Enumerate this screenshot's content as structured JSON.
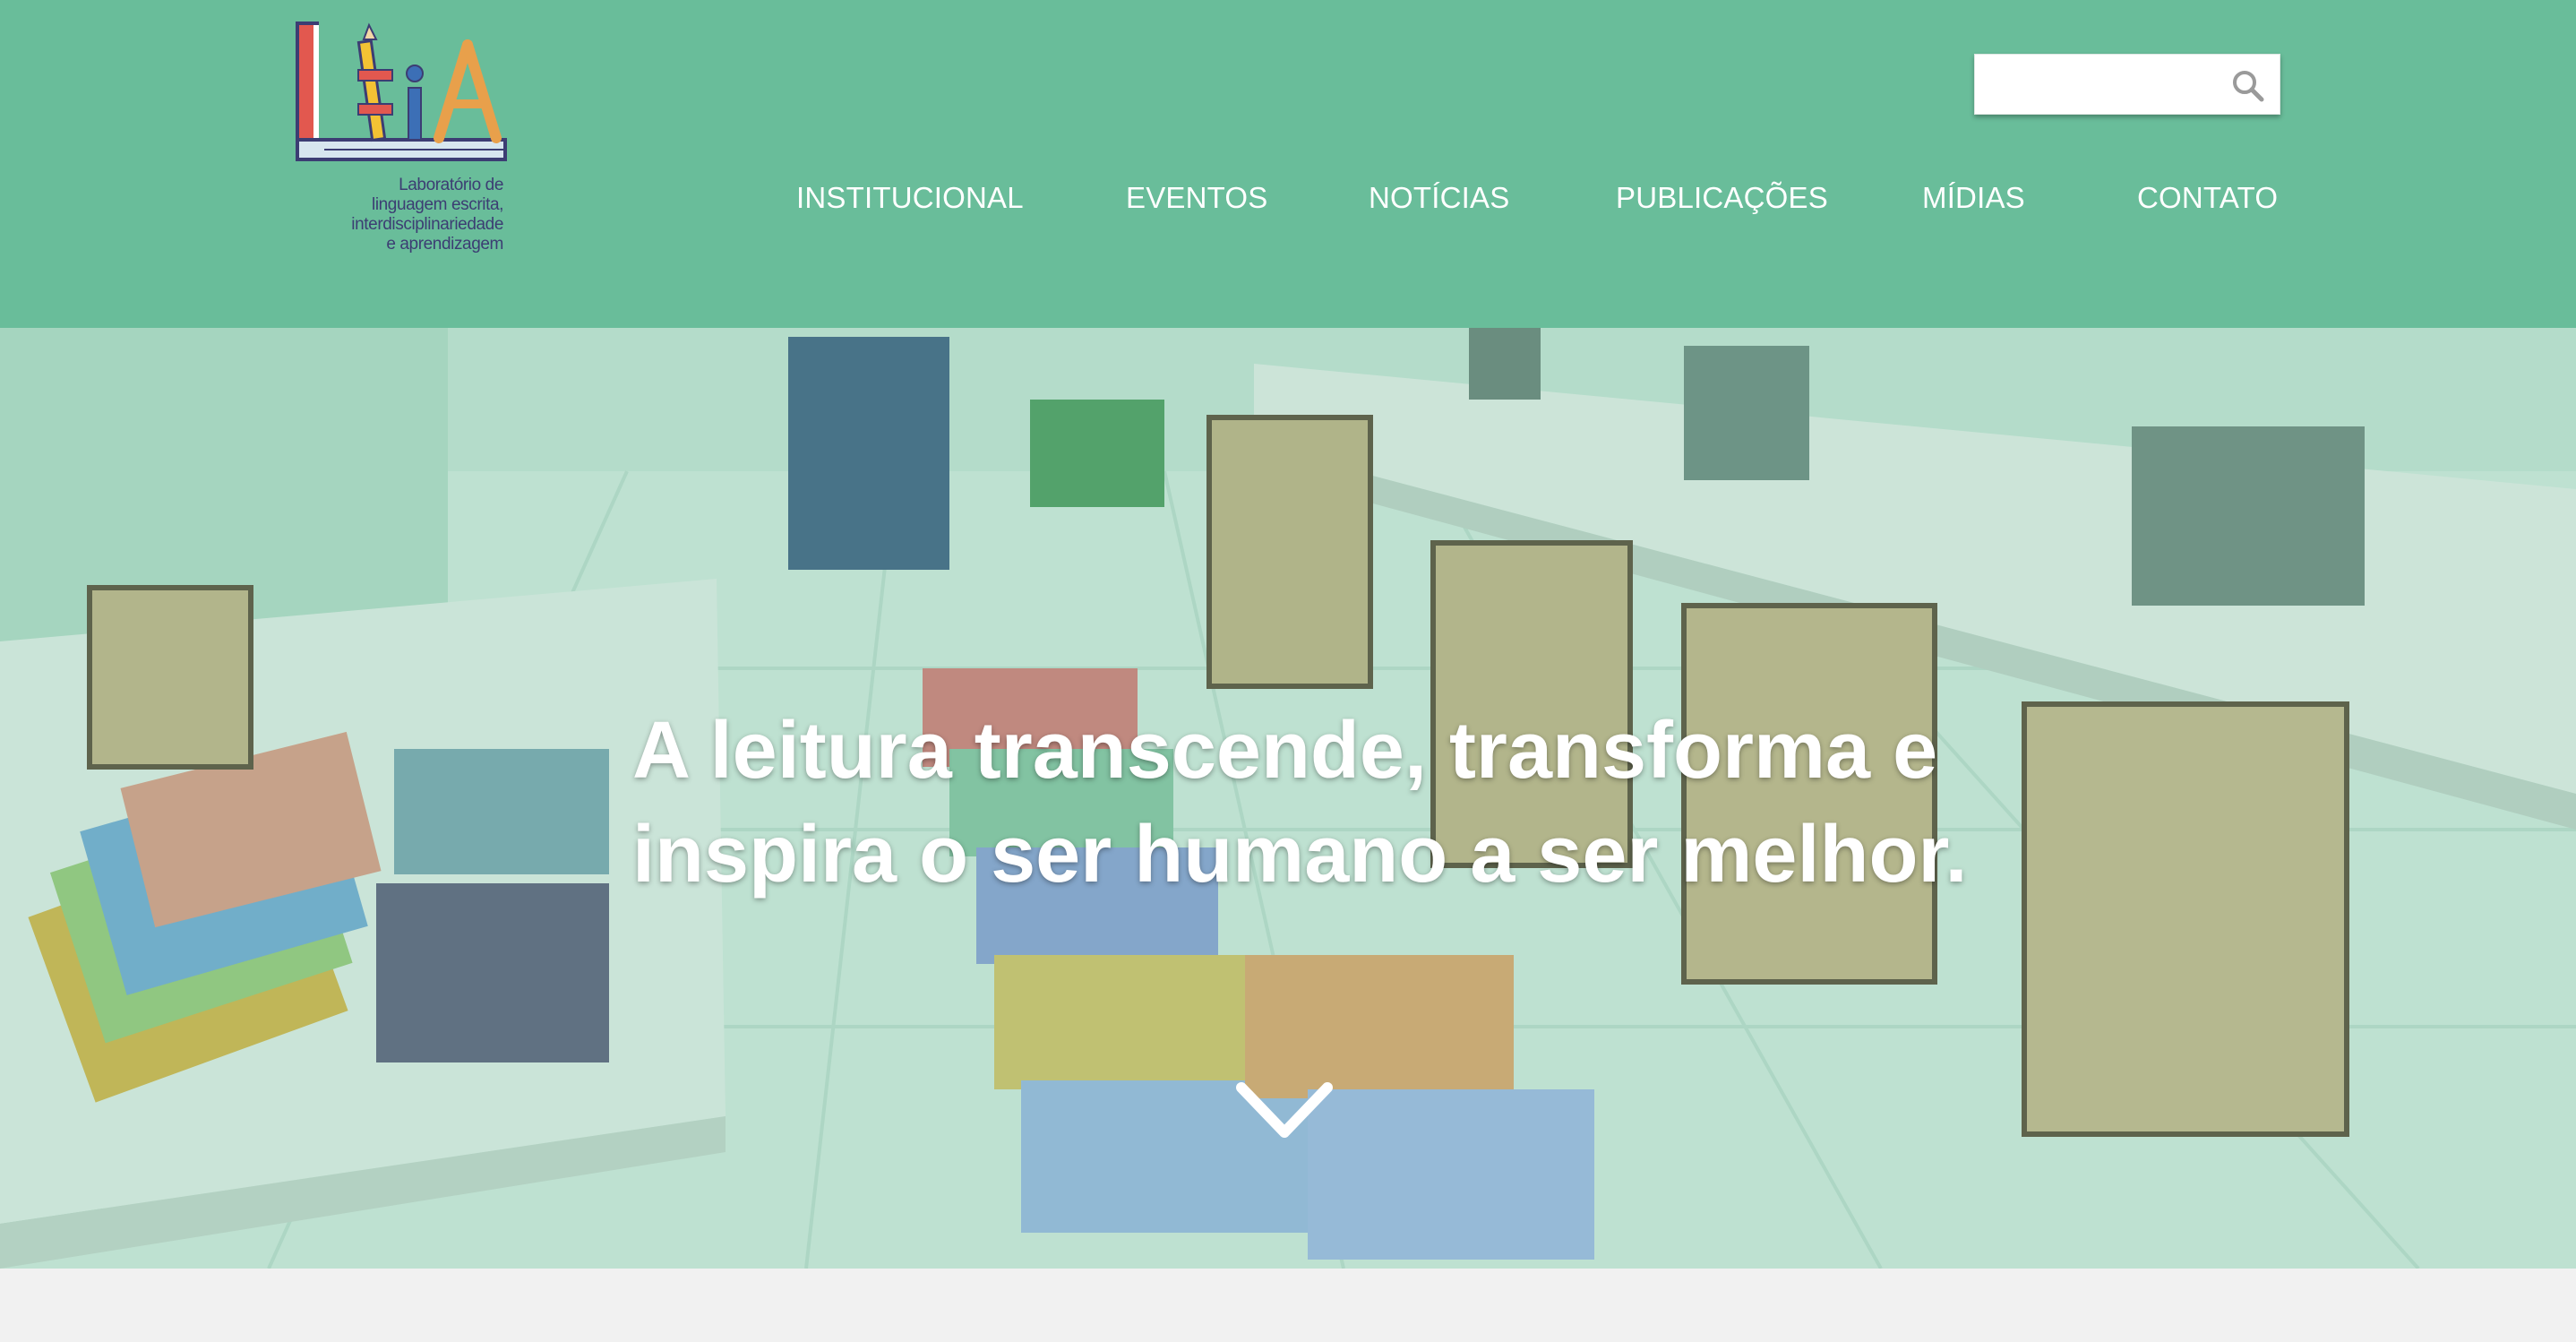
{
  "brand": {
    "logo_letters": "LEIA",
    "caption_lines": [
      "Laboratório de",
      "linguagem escrita,",
      "interdisciplinariedade",
      "e aprendizagem"
    ]
  },
  "search": {
    "placeholder": "",
    "value": "",
    "icon": "search-icon"
  },
  "nav": {
    "items": [
      {
        "label": "INSTITUCIONAL"
      },
      {
        "label": "EVENTOS"
      },
      {
        "label": "NOTÍCIAS"
      },
      {
        "label": "PUBLICAÇÕES"
      },
      {
        "label": "MÍDIAS"
      },
      {
        "label": "CONTATO"
      }
    ]
  },
  "hero": {
    "headline_line1": "A leitura transcende, transforma e",
    "headline_line2": "inspira o ser humano a ser melhor.",
    "scroll_icon": "chevron-down-icon"
  },
  "colors": {
    "header_bg": "#69bd9a",
    "text_white": "#ffffff",
    "logo_text": "#3c3d73",
    "page_bg": "#f1f1f1"
  }
}
